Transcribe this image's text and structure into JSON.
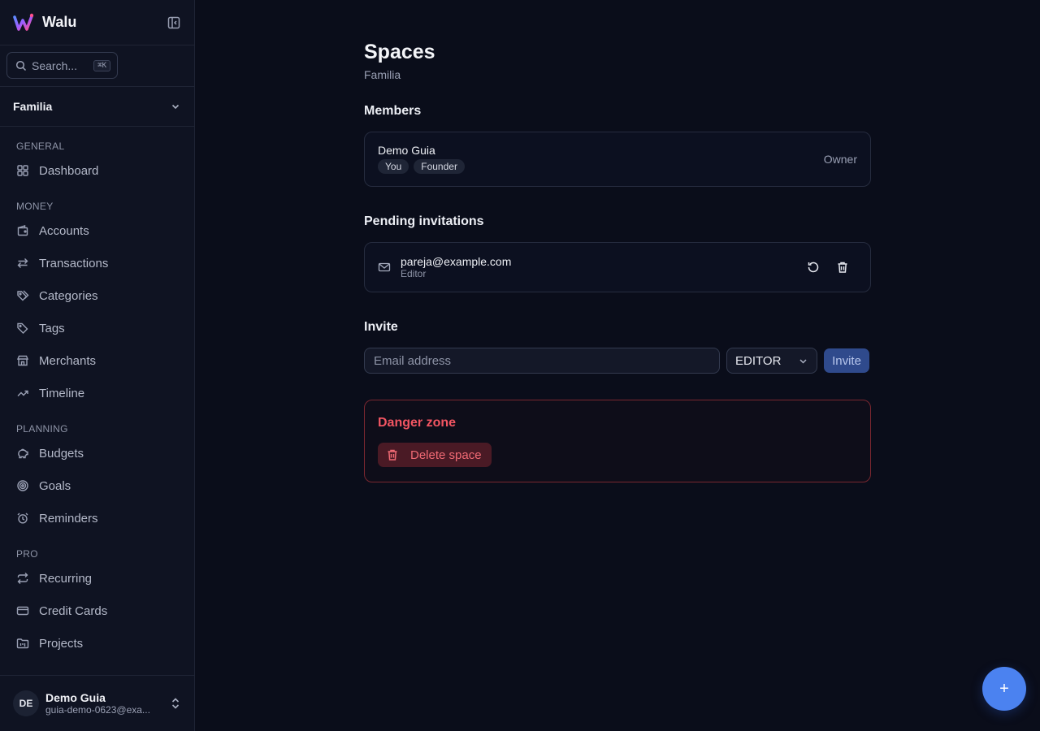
{
  "brand": {
    "name": "Walu"
  },
  "search": {
    "placeholder": "Search...",
    "shortcut": "⌘K"
  },
  "space_selector": {
    "current": "Familia"
  },
  "sidebar": {
    "sections": [
      {
        "label": "GENERAL",
        "items": [
          {
            "label": "Dashboard",
            "icon": "dashboard-icon"
          }
        ]
      },
      {
        "label": "MONEY",
        "items": [
          {
            "label": "Accounts",
            "icon": "wallet-icon"
          },
          {
            "label": "Transactions",
            "icon": "arrows-left-right-icon"
          },
          {
            "label": "Categories",
            "icon": "tags-icon"
          },
          {
            "label": "Tags",
            "icon": "tag-icon"
          },
          {
            "label": "Merchants",
            "icon": "store-icon"
          },
          {
            "label": "Timeline",
            "icon": "trending-up-icon"
          }
        ]
      },
      {
        "label": "PLANNING",
        "items": [
          {
            "label": "Budgets",
            "icon": "piggy-bank-icon"
          },
          {
            "label": "Goals",
            "icon": "target-icon"
          },
          {
            "label": "Reminders",
            "icon": "alarm-clock-icon"
          }
        ]
      },
      {
        "label": "PRO",
        "items": [
          {
            "label": "Recurring",
            "icon": "repeat-icon"
          },
          {
            "label": "Credit Cards",
            "icon": "credit-card-icon"
          },
          {
            "label": "Projects",
            "icon": "folder-kanban-icon"
          }
        ]
      }
    ]
  },
  "user": {
    "initials": "DE",
    "name": "Demo Guia",
    "email": "guia-demo-0623@exa..."
  },
  "page": {
    "title": "Spaces",
    "subtitle": "Familia"
  },
  "members": {
    "heading": "Members",
    "list": [
      {
        "name": "Demo Guia",
        "badges": [
          "You",
          "Founder"
        ],
        "role": "Owner"
      }
    ]
  },
  "pending": {
    "heading": "Pending invitations",
    "list": [
      {
        "email": "pareja@example.com",
        "role": "Editor"
      }
    ]
  },
  "invite": {
    "heading": "Invite",
    "email_placeholder": "Email address",
    "email_value": "",
    "role_value": "EDITOR",
    "button_label": "Invite"
  },
  "danger": {
    "title": "Danger zone",
    "delete_label": "Delete space"
  },
  "fab": {
    "label": "+"
  },
  "colors": {
    "accent": "#4b82f0",
    "danger": "#f25562",
    "background": "#0a0d1a",
    "sidebar": "#0f1322"
  }
}
